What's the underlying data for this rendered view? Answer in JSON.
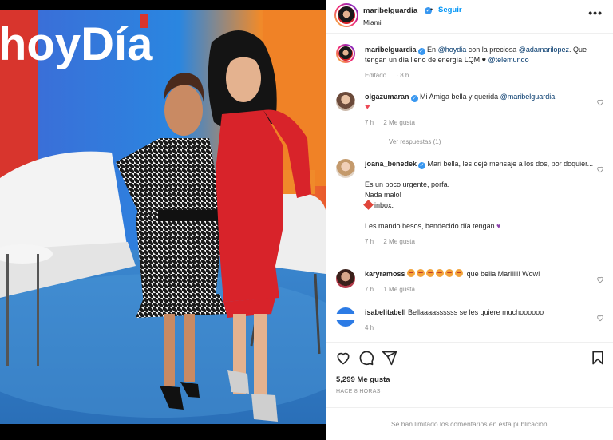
{
  "post": {
    "author": "maribelguardia",
    "follow_label": "Seguir",
    "separator": "•",
    "location": "Miami",
    "more_label": "•••"
  },
  "caption": {
    "user": "maribelguardia",
    "text_1": "En ",
    "mention_1": "@hoydia",
    "text_2": " con la preciosa ",
    "mention_2": "@adamarilopez",
    "text_3": ". Que tengan un día lleno de energía LQM ",
    "heart": "♥",
    "mention_3": "@telemundo",
    "edited": "Editado",
    "time": "8 h"
  },
  "comments": [
    {
      "user": "olgazumaran",
      "verified": true,
      "text": "Mi Amiga bella y querida ",
      "mention": "@maribelguardia",
      "heart": "♥",
      "time": "7 h",
      "likes": "2 Me gusta",
      "replies": "Ver respuestas (1)"
    },
    {
      "user": "joana_benedek",
      "verified": true,
      "line1": "Mari bella, les dejé mensaje a los dos, por doquier...",
      "line2": "Es un poco urgente, porfa.",
      "line3": "Nada malo!",
      "line4": "inbox.",
      "line5": "Les mando besos, bendecido día tengan",
      "time": "7 h",
      "likes": "2 Me gusta"
    },
    {
      "user": "karyramoss",
      "verified": false,
      "text": "que bella Mariiiii! Wow!",
      "time": "7 h",
      "likes": "1 Me gusta"
    },
    {
      "user": "isabelitabell",
      "verified": false,
      "text": "Bellaaaassssss se les quiere muchoooooo",
      "time": "4 h"
    }
  ],
  "engagement": {
    "likes": "5,299 Me gusta",
    "when": "HACE 8 HORAS",
    "comments_limited": "Se han limitado los comentarios en esta publicación."
  },
  "photo": {
    "studio_sign": "hoyDía"
  },
  "colors": {
    "accent": "#0095f6",
    "verified": "#3897f0",
    "heart": "#ed4956",
    "muted": "#8e8e8e"
  },
  "icons": [
    "heart-icon",
    "comment-icon",
    "share-icon",
    "bookmark-icon",
    "more-icon",
    "verified-icon"
  ]
}
